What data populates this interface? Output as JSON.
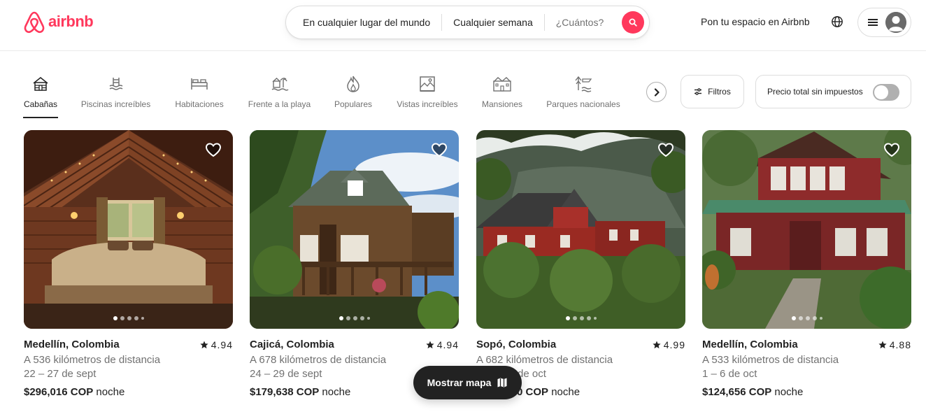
{
  "header": {
    "logo_text": "airbnb",
    "brand_color": "#FF385C",
    "search": {
      "location": "En cualquier lugar del mundo",
      "dates": "Cualquier semana",
      "guests": "¿Cuántos?"
    },
    "host_link": "Pon tu espacio en Airbnb"
  },
  "categories": [
    {
      "label": "Cabañas",
      "icon": "cabin-icon",
      "active": true
    },
    {
      "label": "Piscinas increíbles",
      "icon": "pool-icon",
      "active": false
    },
    {
      "label": "Habitaciones",
      "icon": "bed-icon",
      "active": false
    },
    {
      "label": "Frente a la playa",
      "icon": "beach-icon",
      "active": false
    },
    {
      "label": "Populares",
      "icon": "flame-icon",
      "active": false
    },
    {
      "label": "Vistas increíbles",
      "icon": "view-icon",
      "active": false
    },
    {
      "label": "Mansiones",
      "icon": "mansion-icon",
      "active": false
    },
    {
      "label": "Parques nacionales",
      "icon": "park-icon",
      "active": false
    }
  ],
  "filters_label": "Filtros",
  "price_toggle_label": "Precio total sin impuestos",
  "listings": [
    {
      "location": "Medellín, Colombia",
      "rating": "4.94",
      "distance": "A 536 kilómetros de distancia",
      "dates": "22 – 27 de sept",
      "price": "$296,016 COP",
      "unit": "noche"
    },
    {
      "location": "Cajicá, Colombia",
      "rating": "4.94",
      "distance": "A 678 kilómetros de distancia",
      "dates": "24 – 29 de sept",
      "price": "$179,638 COP",
      "unit": "noche"
    },
    {
      "location": "Sopó, Colombia",
      "rating": "4.99",
      "distance": "A 682 kilómetros de distancia",
      "dates": "de oct",
      "price": "0 COP",
      "unit": "noche"
    },
    {
      "location": "Medellín, Colombia",
      "rating": "4.88",
      "distance": "A 533 kilómetros de distancia",
      "dates": "1 – 6 de oct",
      "price": "$124,656 COP",
      "unit": "noche"
    }
  ],
  "map_button_label": "Mostrar mapa"
}
